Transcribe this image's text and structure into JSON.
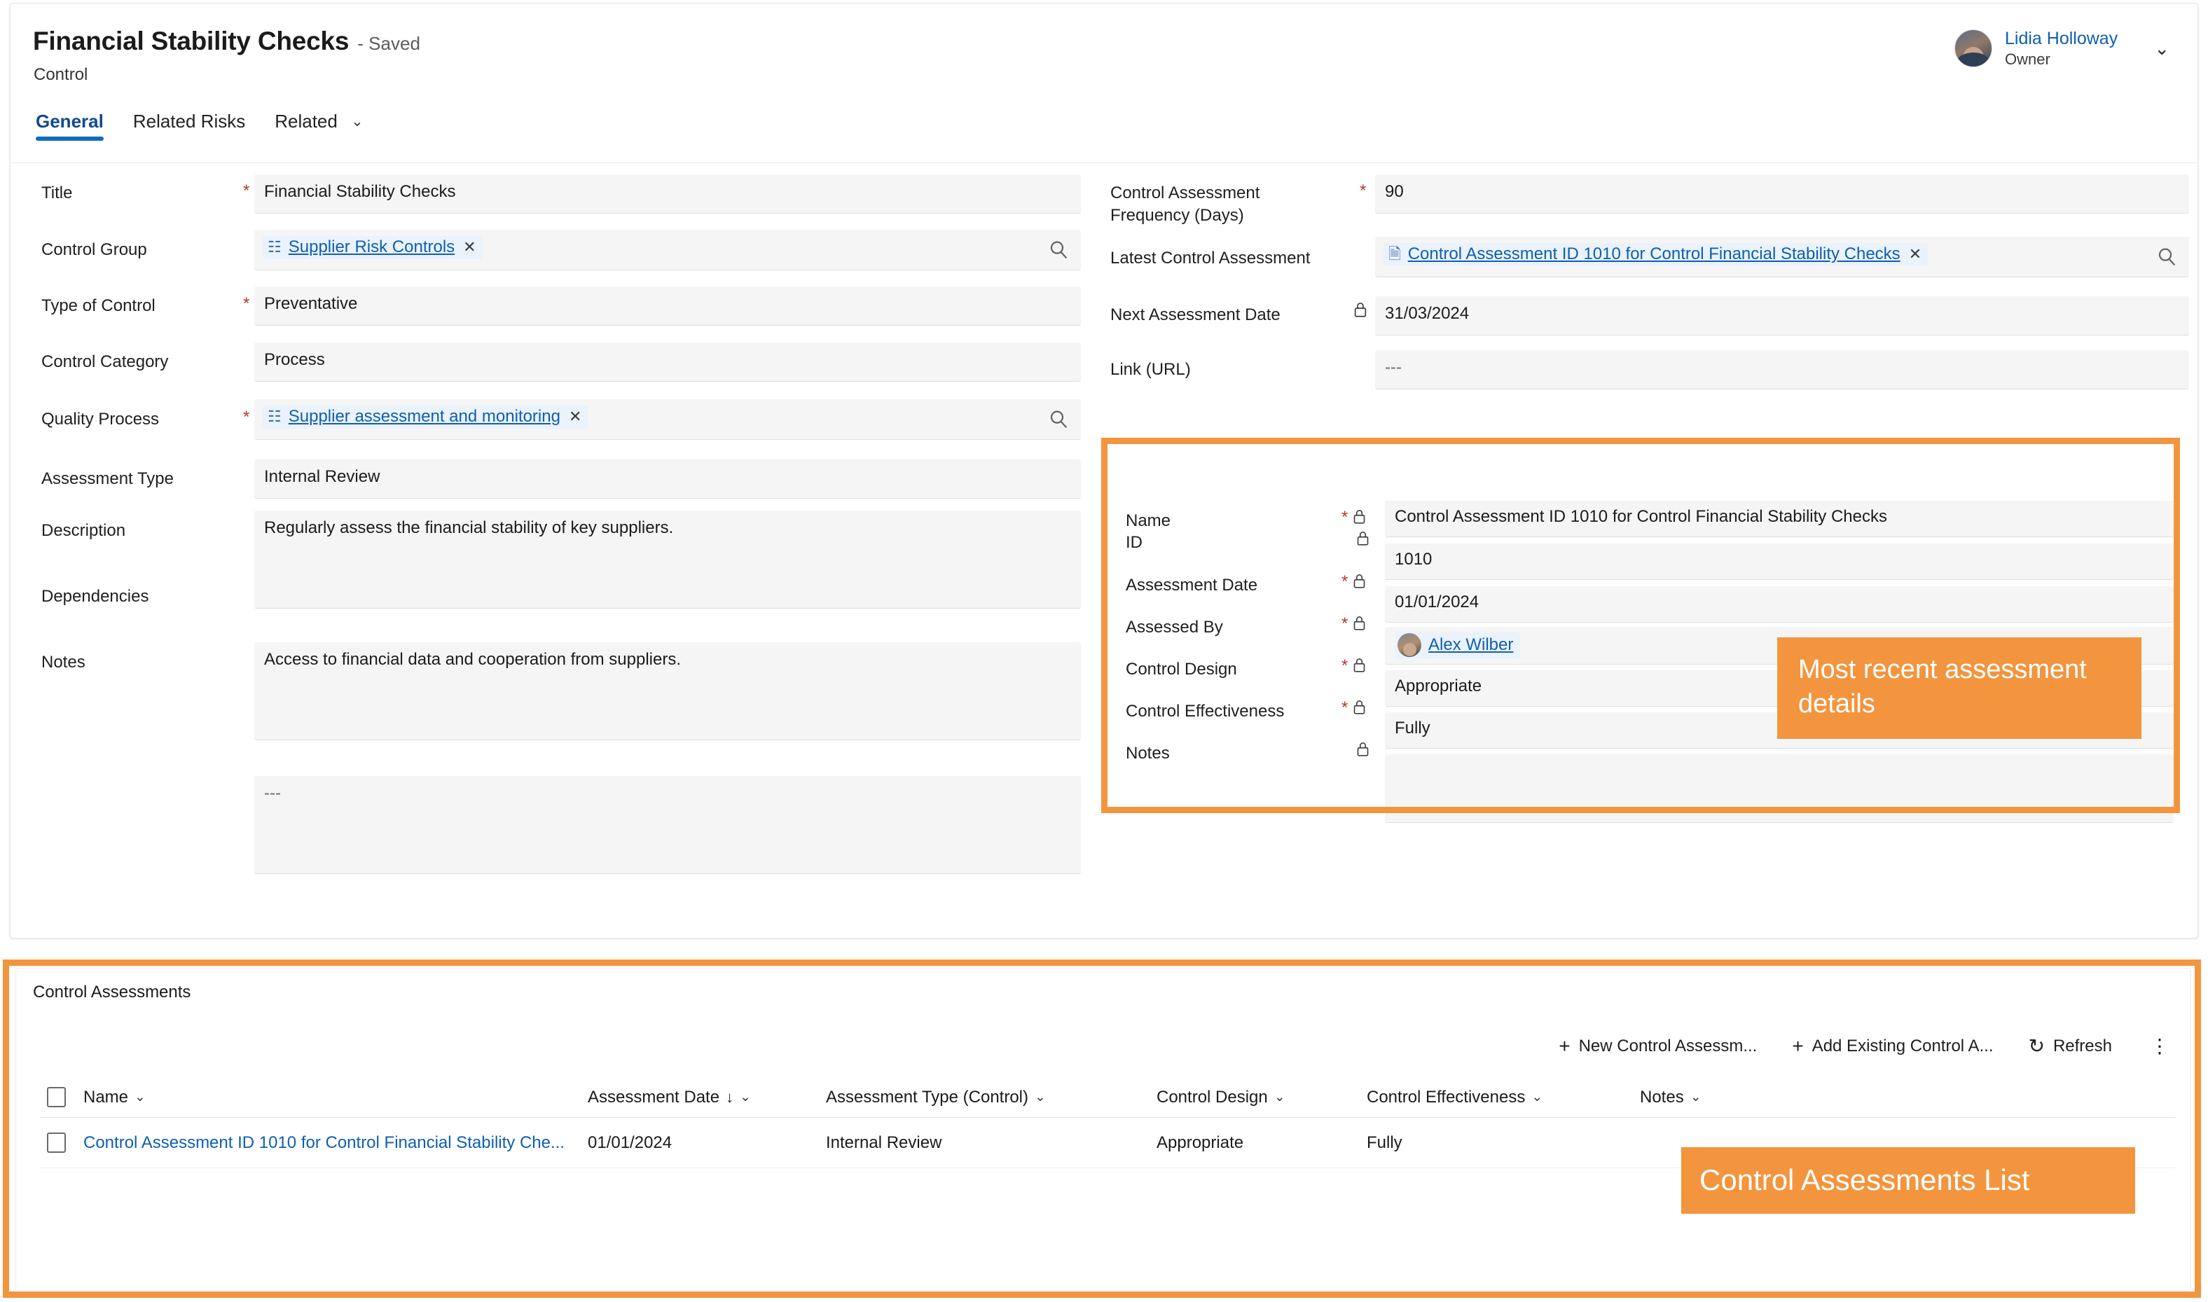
{
  "header": {
    "record_title": "Financial Stability Checks",
    "saved_state": "- Saved",
    "entity_label": "Control",
    "tabs": [
      {
        "label": "General",
        "active": true,
        "has_chevron": false
      },
      {
        "label": "Related Risks",
        "active": false,
        "has_chevron": false
      },
      {
        "label": "Related",
        "active": false,
        "has_chevron": true
      }
    ],
    "chevron_glyph": "⌄",
    "user": {
      "name": "Lidia Holloway",
      "role": "Owner",
      "chevron_glyph": "⌄"
    }
  },
  "form": {
    "left_fields": [
      {
        "label": "Title",
        "required": true,
        "locked": false,
        "value": "Financial Stability Checks",
        "kind": "text"
      },
      {
        "label": "Control Group",
        "required": false,
        "locked": false,
        "value": "Supplier Risk Controls",
        "kind": "lookup",
        "icon": "record-icon",
        "remove_glyph": "✕",
        "lookup_icon": "search-icon"
      },
      {
        "label": "Type of Control",
        "required": true,
        "locked": false,
        "value": "Preventative",
        "kind": "text"
      },
      {
        "label": "Control Category",
        "required": false,
        "locked": false,
        "value": "Process",
        "kind": "text"
      },
      {
        "label": "Quality Process",
        "required": true,
        "locked": false,
        "value": "Supplier assessment and monitoring",
        "kind": "lookup",
        "icon": "record-icon",
        "remove_glyph": "✕",
        "lookup_icon": "search-icon"
      },
      {
        "label": "Assessment Type",
        "required": false,
        "locked": false,
        "value": "Internal Review",
        "kind": "text"
      },
      {
        "label": "Description",
        "required": false,
        "locked": false,
        "value": "Regularly assess the financial stability of key suppliers.",
        "kind": "textarea"
      },
      {
        "label": "Dependencies",
        "required": false,
        "locked": false,
        "value": "Access to financial data and cooperation from suppliers.",
        "kind": "textarea"
      },
      {
        "label": "Notes",
        "required": false,
        "locked": false,
        "value": "---",
        "kind": "textarea",
        "dim": true
      }
    ],
    "right_fields": [
      {
        "label": "Control Assessment Frequency (Days)",
        "required": true,
        "locked": false,
        "value": "90",
        "kind": "text"
      },
      {
        "label": "Latest Control Assessment",
        "required": false,
        "locked": false,
        "value": "Control Assessment ID 1010 for Control Financial Stability Checks",
        "kind": "lookup",
        "icon": "document-icon",
        "remove_glyph": "✕",
        "lookup_icon": "search-icon"
      },
      {
        "label": "Next Assessment Date",
        "required": false,
        "locked": true,
        "value": "31/03/2024",
        "kind": "text"
      },
      {
        "label": "Link (URL)",
        "required": false,
        "locked": false,
        "value": "---",
        "kind": "text",
        "dim": true
      }
    ],
    "assessment_panel": [
      {
        "label": "Name",
        "required": true,
        "locked": true,
        "value": "Control Assessment ID 1010 for Control Financial Stability Checks",
        "kind": "text"
      },
      {
        "label": "ID",
        "required": false,
        "locked": true,
        "value": "1010",
        "kind": "text"
      },
      {
        "label": "Assessment Date",
        "required": true,
        "locked": true,
        "value": "01/01/2024",
        "kind": "text"
      },
      {
        "label": "Assessed By",
        "required": true,
        "locked": true,
        "value": "Alex Wilber",
        "kind": "person"
      },
      {
        "label": "Control Design",
        "required": true,
        "locked": true,
        "value": "Appropriate",
        "kind": "text"
      },
      {
        "label": "Control Effectiveness",
        "required": true,
        "locked": true,
        "value": "Fully",
        "kind": "text"
      },
      {
        "label": "Notes",
        "required": false,
        "locked": true,
        "value": "",
        "kind": "textarea"
      }
    ],
    "lock_glyph": "ὑ2"
  },
  "callouts": {
    "assessment": "Most recent assessment details",
    "list": "Control Assessments List",
    "color": "#F2953E"
  },
  "list_section": {
    "title": "Control Assessments",
    "toolbar": [
      {
        "label": "New Control Assessm...",
        "icon": "plus-icon",
        "glyph": "+"
      },
      {
        "label": "Add Existing Control A...",
        "icon": "plus-icon",
        "glyph": "+"
      },
      {
        "label": "Refresh",
        "icon": "refresh-icon",
        "glyph": "↻"
      }
    ],
    "more_glyph": "⋮",
    "columns": [
      {
        "label": "Name",
        "sorted": false,
        "chevron": "⌄"
      },
      {
        "label": "Assessment Date",
        "sorted": true,
        "sort_glyph": "↓",
        "chevron": "⌄"
      },
      {
        "label": "Assessment Type (Control)",
        "sorted": false,
        "chevron": "⌄"
      },
      {
        "label": "Control Design",
        "sorted": false,
        "chevron": "⌄"
      },
      {
        "label": "Control Effectiveness",
        "sorted": false,
        "chevron": "⌄"
      },
      {
        "label": "Notes",
        "sorted": false,
        "chevron": "⌄"
      }
    ],
    "rows": [
      {
        "name": "Control Assessment ID 1010 for Control Financial Stability Che...",
        "assessment_date": "01/01/2024",
        "assessment_type": "Internal Review",
        "control_design": "Appropriate",
        "control_effectiveness": "Fully",
        "notes": ""
      }
    ]
  }
}
